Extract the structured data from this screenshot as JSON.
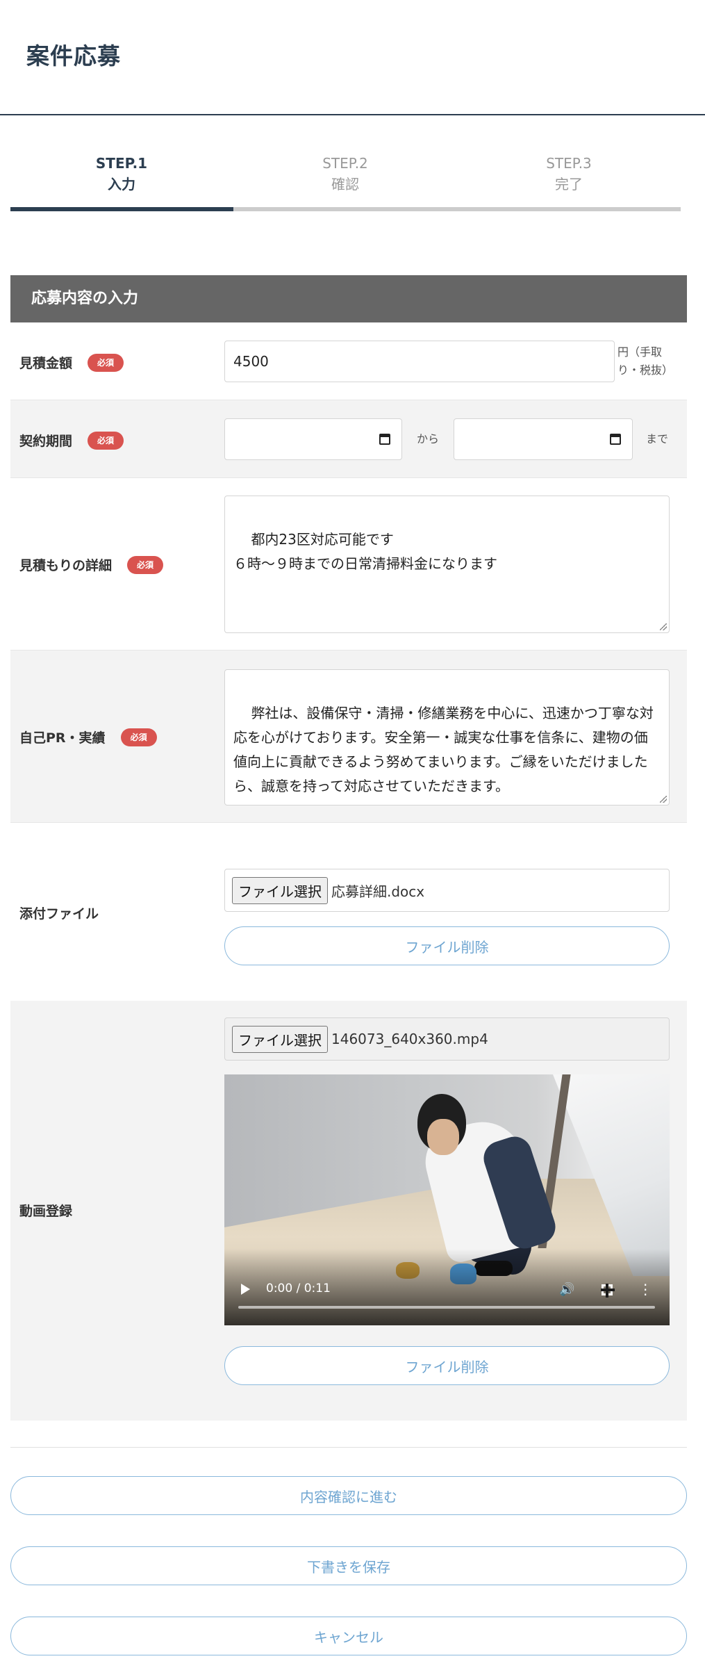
{
  "page": {
    "title": "案件応募"
  },
  "steps": [
    {
      "num": "STEP.1",
      "label": "入力",
      "active": true
    },
    {
      "num": "STEP.2",
      "label": "確認",
      "active": false
    },
    {
      "num": "STEP.3",
      "label": "完了",
      "active": false
    }
  ],
  "progress": {
    "completed_fraction": 0.333
  },
  "section": {
    "title": "応募内容の入力"
  },
  "form": {
    "required_badge": "必須",
    "estimate": {
      "label": "見積金額",
      "value": "4500",
      "unit_note": "円（手取り・税抜）"
    },
    "period": {
      "label": "契約期間",
      "from_value": "",
      "to_value": "",
      "from_text": "から",
      "to_text": "まで"
    },
    "details": {
      "label": "見積もりの詳細",
      "value": "都内23区対応可能です\n６時〜９時までの日常清掃料金になります"
    },
    "pr": {
      "label": "自己PR・実績",
      "value": "弊社は、設備保守・清掃・修繕業務を中心に、迅速かつ丁寧な対応を心がけております。安全第一・誠実な仕事を信条に、建物の価値向上に貢献できるよう努めてまいります。ご縁をいただけましたら、誠意を持って対応させていただきます。"
    },
    "attachment": {
      "label": "添付ファイル",
      "choose_label": "ファイル選択",
      "file_name": "応募詳細.docx",
      "delete_label": "ファイル削除"
    },
    "video": {
      "label": "動画登録",
      "choose_label": "ファイル選択",
      "file_name": "146073_640x360.mp4",
      "delete_label": "ファイル削除",
      "time": "0:00 / 0:11",
      "progress": 0
    }
  },
  "actions": {
    "confirm_label": "内容確認に進む",
    "draft_label": "下書きを保存",
    "cancel_label": "キャンセル"
  },
  "colors": {
    "primary": "#2c3e50",
    "badge": "#d9534f",
    "button_text": "#6ea5d1",
    "section_header": "#666666"
  }
}
